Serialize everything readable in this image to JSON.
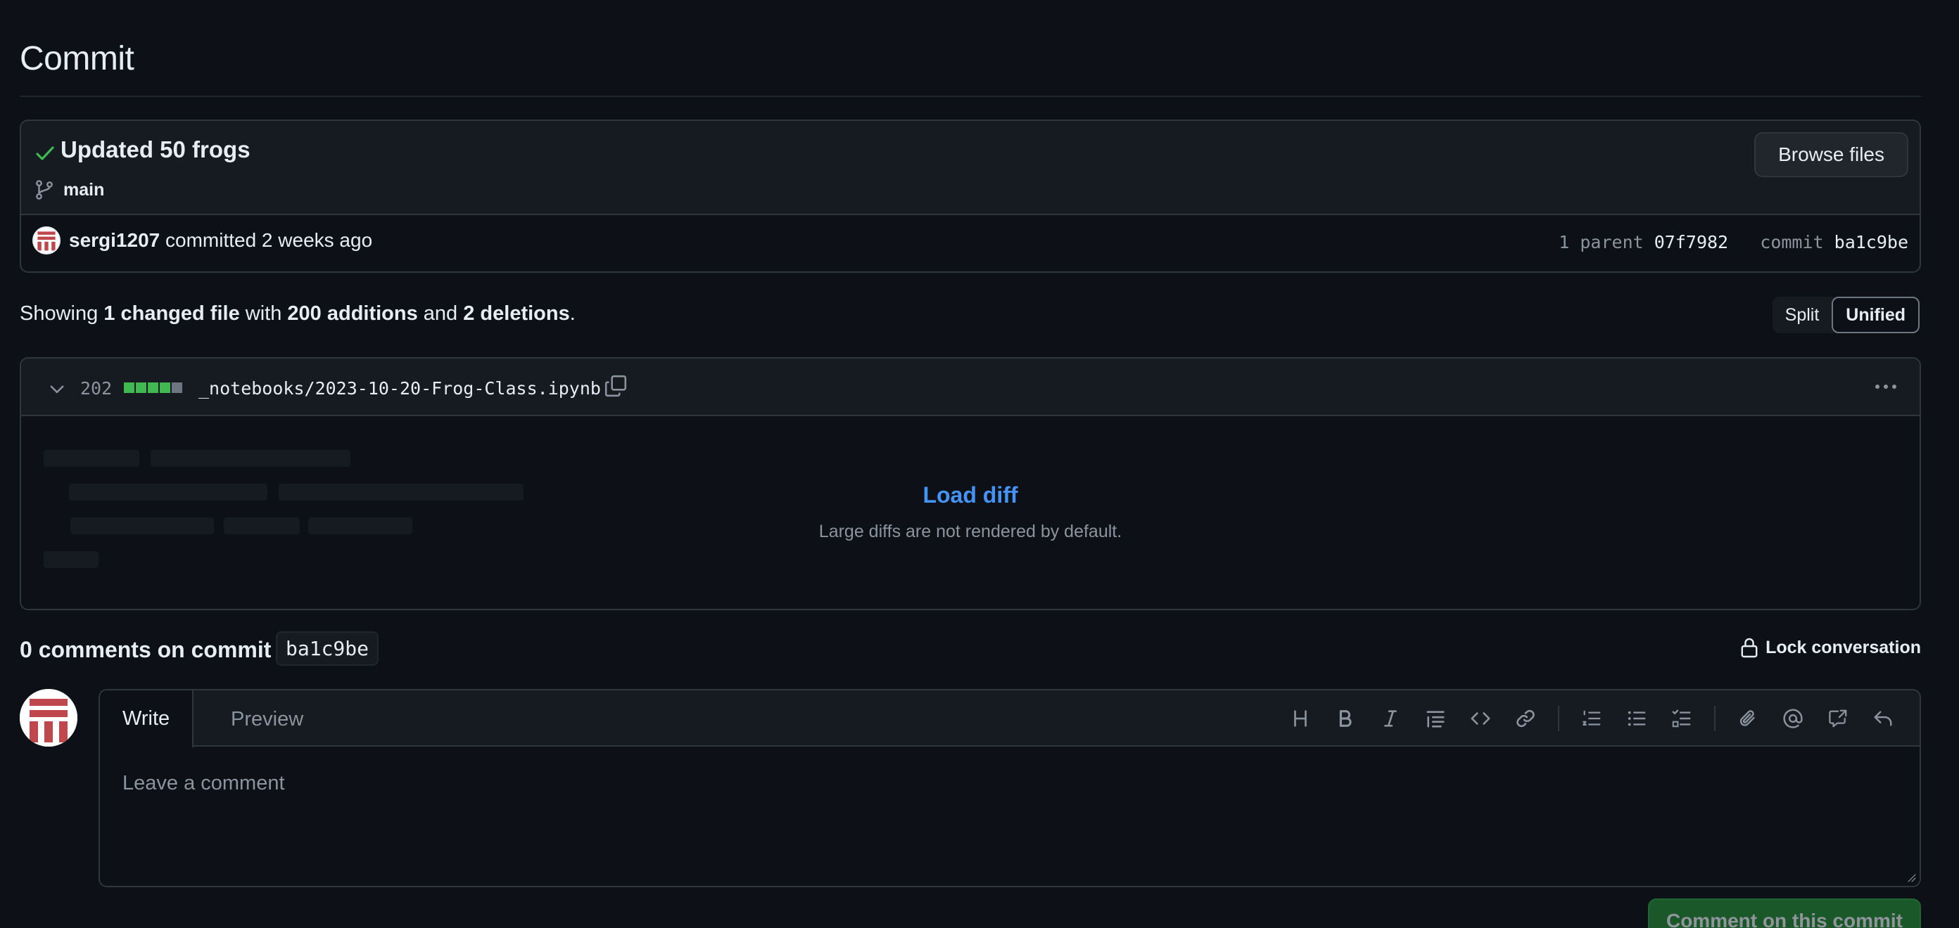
{
  "page": {
    "title": "Commit"
  },
  "commit": {
    "message": "Updated 50 frogs",
    "branch": "main",
    "browse_label": "Browse files",
    "author": "sergi1207",
    "committed_text": "committed 2 weeks ago",
    "parent_label": "1 parent",
    "parent_sha": "07f7982",
    "commit_label": "commit",
    "sha": "ba1c9be"
  },
  "summary": {
    "prefix": "Showing",
    "files": "1 changed file",
    "with": "with",
    "additions": "200 additions",
    "and": "and",
    "deletions": "2 deletions",
    "suffix": "."
  },
  "view_toggle": {
    "split": "Split",
    "unified": "Unified",
    "selected": "Unified"
  },
  "diff": {
    "line_count": "202",
    "filename": "_notebooks/2023-10-20-Frog-Class.ipynb",
    "load_label": "Load diff",
    "note": "Large diffs are not rendered by default.",
    "diffstat_blocks": [
      "added",
      "added",
      "added",
      "added",
      "neutral"
    ]
  },
  "comments": {
    "title": "0 comments on commit",
    "sha": "ba1c9be",
    "lock_label": "Lock conversation"
  },
  "editor": {
    "tab_write": "Write",
    "tab_preview": "Preview",
    "placeholder": "Leave a comment",
    "toolbar": [
      [
        "heading-icon",
        "bold-icon",
        "italic-icon",
        "quote-icon",
        "code-icon",
        "link-icon"
      ],
      [
        "ordered-list-icon",
        "unordered-list-icon",
        "task-list-icon"
      ],
      [
        "attach-icon",
        "mention-icon",
        "cross-reference-icon",
        "reply-icon"
      ]
    ],
    "submit_label": "Comment on this commit"
  },
  "colors": {
    "background": "#0d1117",
    "panel": "#161b22",
    "border": "#30363d",
    "link": "#4493f8",
    "success": "#3fb950",
    "button_primary": "#238636",
    "avatar_red": "#c0474b"
  }
}
